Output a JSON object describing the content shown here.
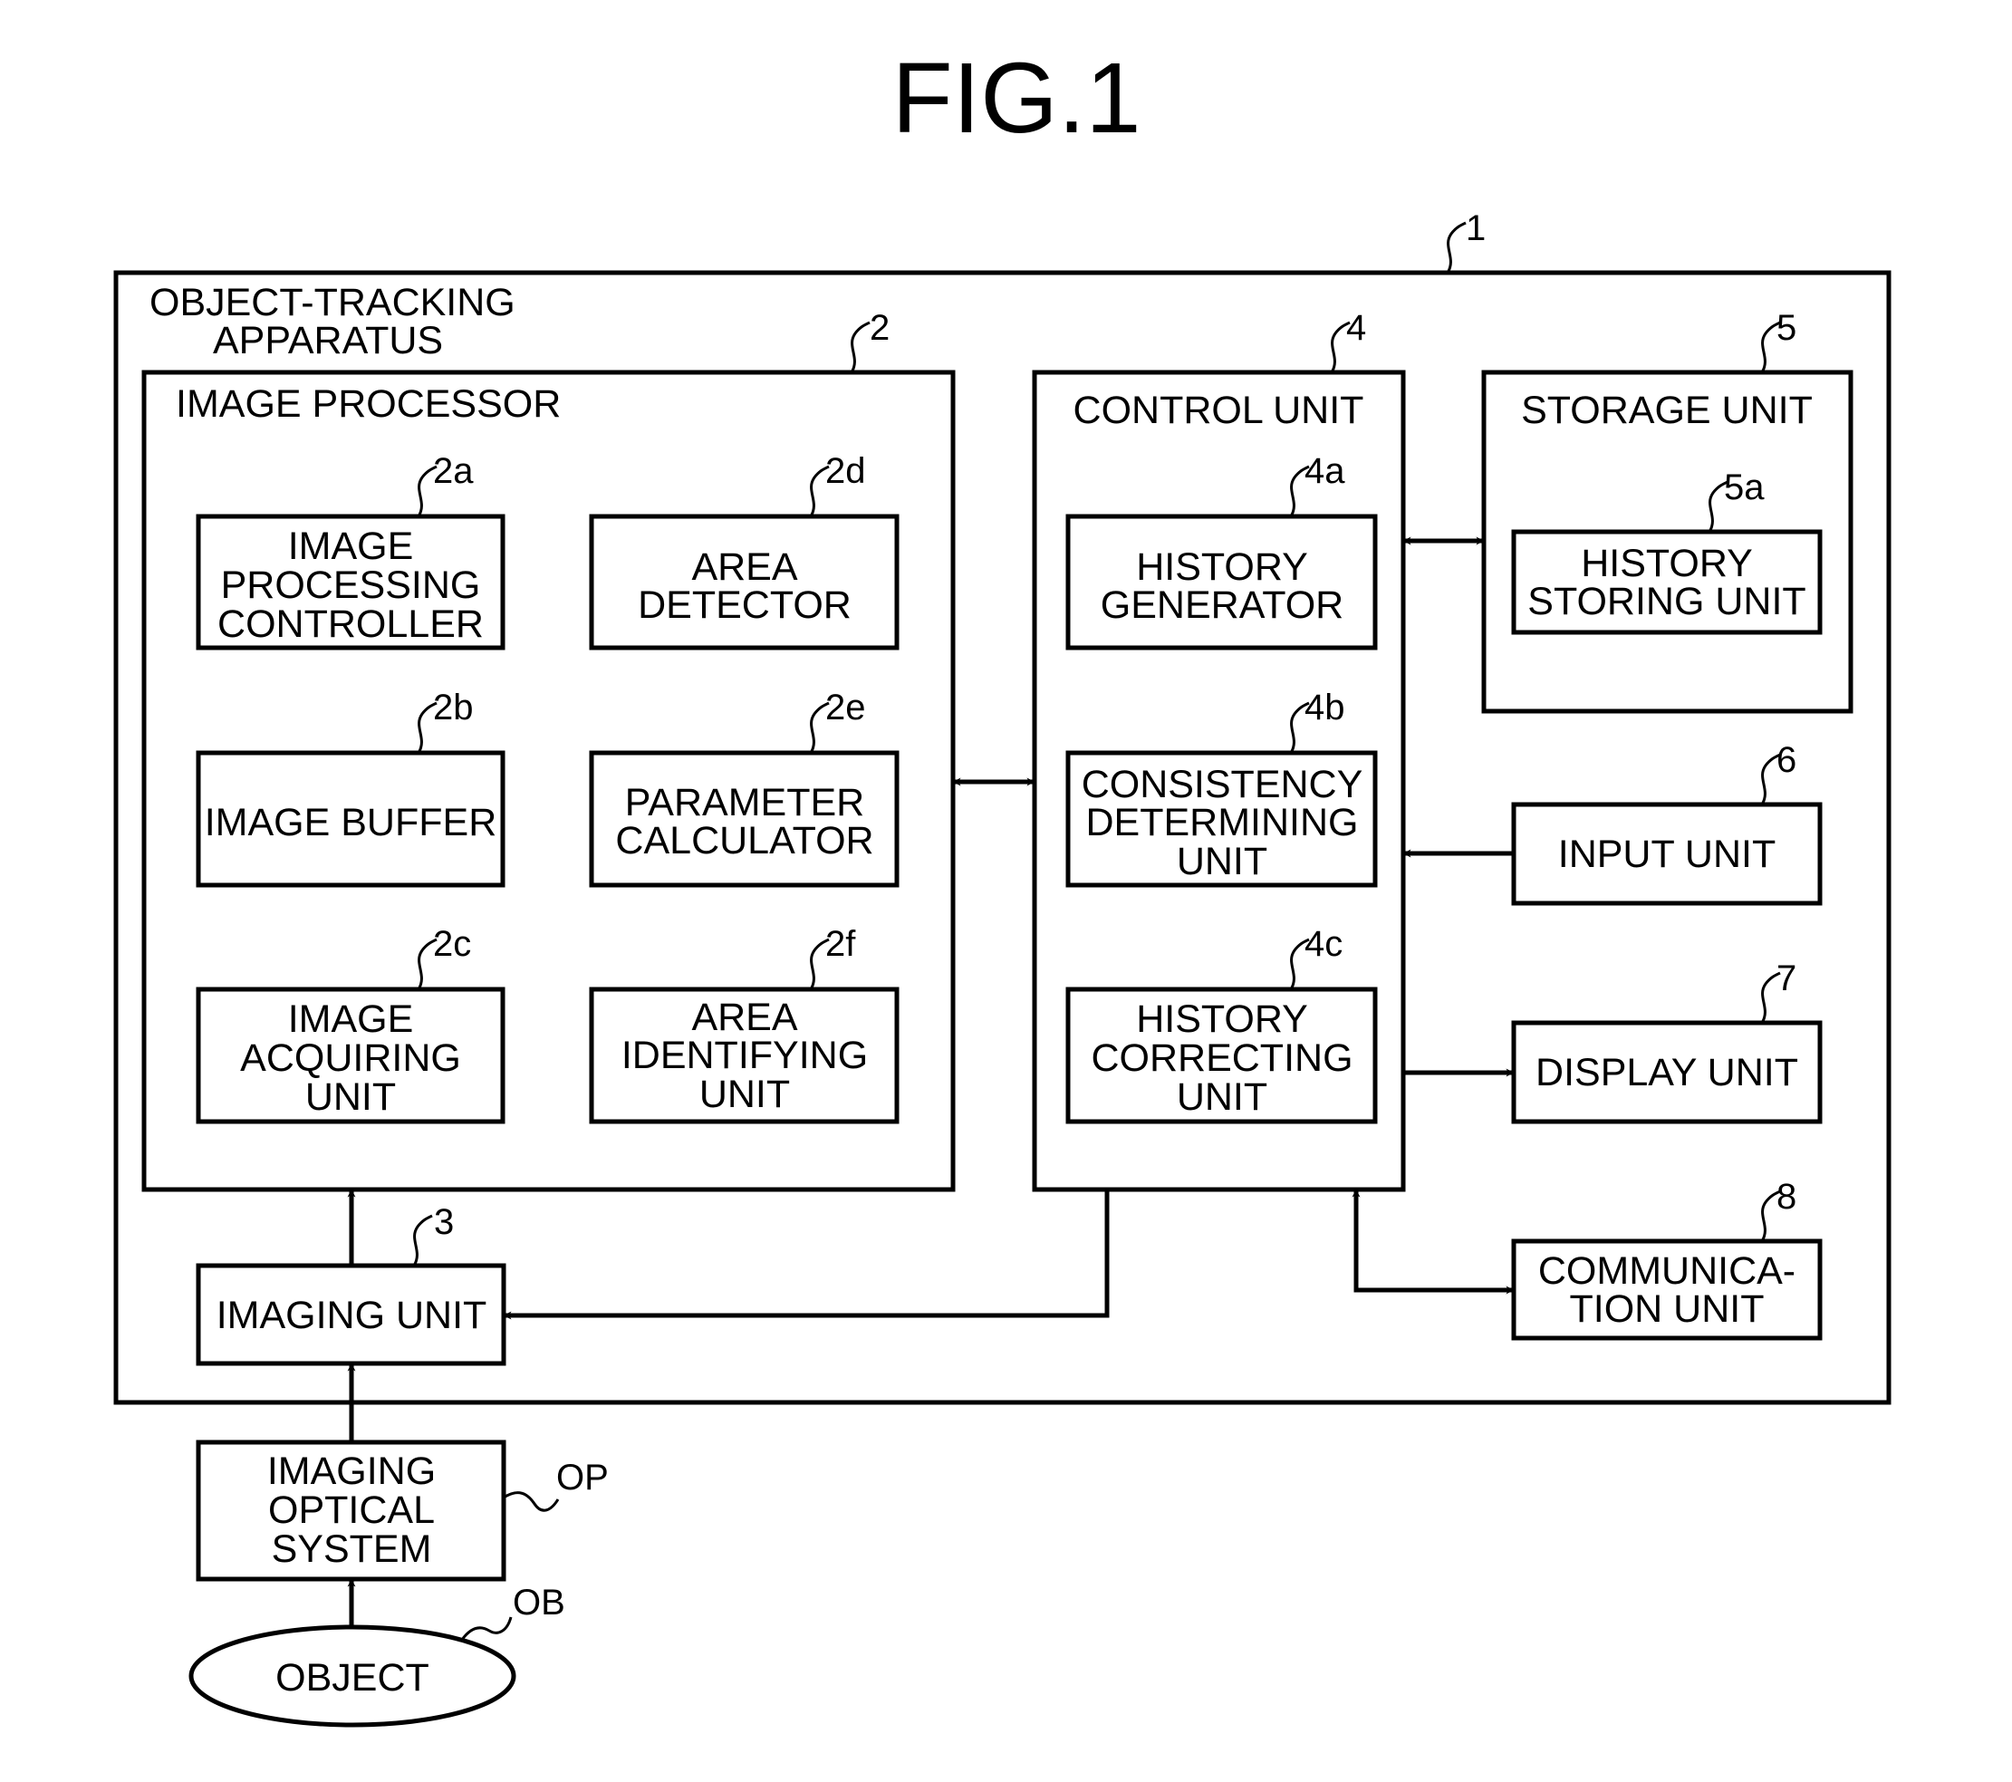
{
  "figure": {
    "title": "FIG.1",
    "apparatus": {
      "ref": "1",
      "label_lines": [
        "OBJECT-TRACKING",
        "APPARATUS"
      ]
    },
    "image_processor": {
      "ref": "2",
      "label": "IMAGE PROCESSOR",
      "blocks": [
        {
          "ref": "2a",
          "lines": [
            "IMAGE",
            "PROCESSING",
            "CONTROLLER"
          ]
        },
        {
          "ref": "2b",
          "lines": [
            "IMAGE BUFFER"
          ]
        },
        {
          "ref": "2c",
          "lines": [
            "IMAGE",
            "ACQUIRING",
            "UNIT"
          ]
        },
        {
          "ref": "2d",
          "lines": [
            "AREA",
            "DETECTOR"
          ]
        },
        {
          "ref": "2e",
          "lines": [
            "PARAMETER",
            "CALCULATOR"
          ]
        },
        {
          "ref": "2f",
          "lines": [
            "AREA",
            "IDENTIFYING",
            "UNIT"
          ]
        }
      ]
    },
    "imaging_unit": {
      "ref": "3",
      "lines": [
        "IMAGING UNIT"
      ]
    },
    "control_unit": {
      "ref": "4",
      "label": "CONTROL UNIT",
      "blocks": [
        {
          "ref": "4a",
          "lines": [
            "HISTORY",
            "GENERATOR"
          ]
        },
        {
          "ref": "4b",
          "lines": [
            "CONSISTENCY",
            "DETERMINING",
            "UNIT"
          ]
        },
        {
          "ref": "4c",
          "lines": [
            "HISTORY",
            "CORRECTING",
            "UNIT"
          ]
        }
      ]
    },
    "storage_unit": {
      "ref": "5",
      "label": "STORAGE UNIT",
      "block": {
        "ref": "5a",
        "lines": [
          "HISTORY",
          "STORING UNIT"
        ]
      }
    },
    "input_unit": {
      "ref": "6",
      "lines": [
        "INPUT UNIT"
      ]
    },
    "display_unit": {
      "ref": "7",
      "lines": [
        "DISPLAY UNIT"
      ]
    },
    "communication_unit": {
      "ref": "8",
      "lines": [
        "COMMUNICA-",
        "TION UNIT"
      ]
    },
    "optical_system": {
      "ref": "OP",
      "lines": [
        "IMAGING",
        "OPTICAL",
        "SYSTEM"
      ]
    },
    "object": {
      "ref": "OB",
      "lines": [
        "OBJECT"
      ]
    }
  }
}
